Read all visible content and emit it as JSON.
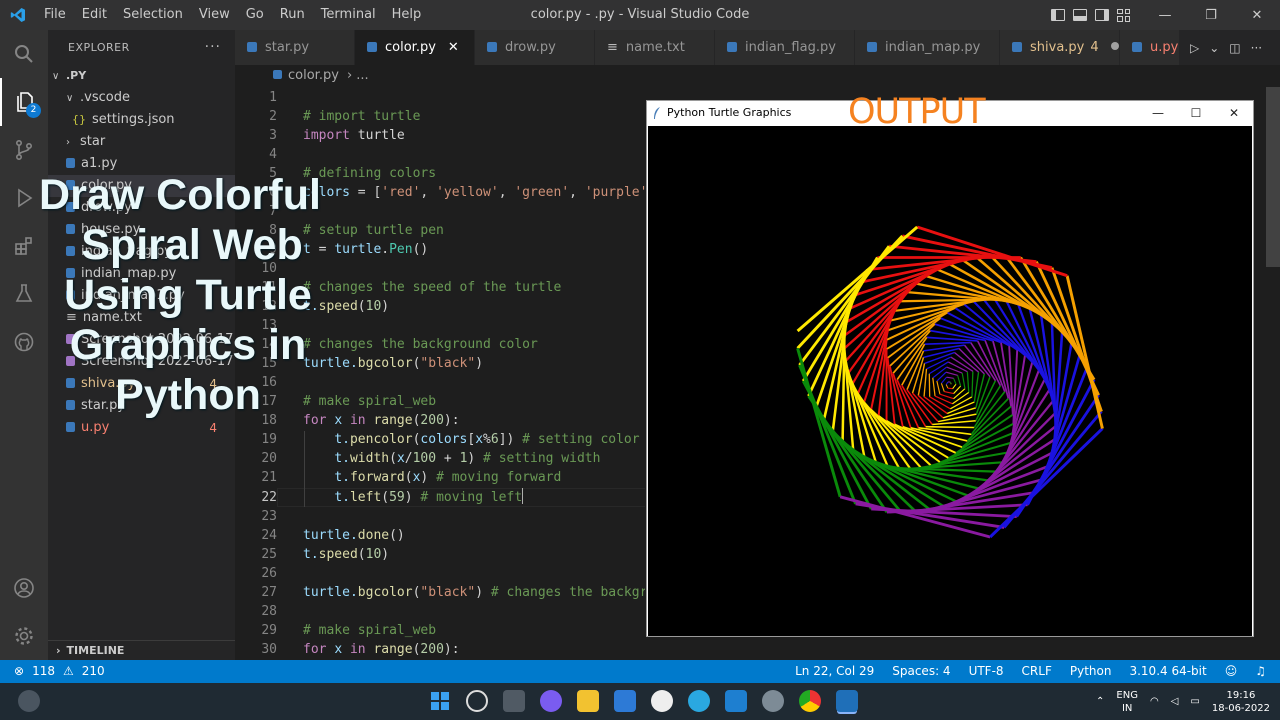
{
  "window": {
    "title": "color.py - .py - Visual Studio Code",
    "menu": [
      "File",
      "Edit",
      "Selection",
      "View",
      "Go",
      "Run",
      "Terminal",
      "Help"
    ]
  },
  "activity": {
    "explorer_badge": "2"
  },
  "sidebar": {
    "header": "EXPLORER",
    "root": ".PY",
    "items": [
      {
        "label": ".vscode",
        "kind": "folder-open"
      },
      {
        "label": "settings.json",
        "kind": "json"
      },
      {
        "label": "star",
        "kind": "folder"
      },
      {
        "label": "a1.py",
        "kind": "py"
      },
      {
        "label": "color.py",
        "kind": "py"
      },
      {
        "label": "drow.py",
        "kind": "py"
      },
      {
        "label": "house.py",
        "kind": "py"
      },
      {
        "label": "indian_flag.py",
        "kind": "py"
      },
      {
        "label": "indian_map.py",
        "kind": "py"
      },
      {
        "label": "indian_map1.py",
        "kind": "py"
      },
      {
        "label": "name.txt",
        "kind": "txt"
      },
      {
        "label": "Screenshot 2022-06-17 ...",
        "kind": "img"
      },
      {
        "label": "Screenshot 2022-06-17 ...",
        "kind": "img"
      },
      {
        "label": "shiva.py",
        "kind": "py",
        "badge": "4"
      },
      {
        "label": "star.py",
        "kind": "py"
      },
      {
        "label": "u.py",
        "kind": "py",
        "badge": "4"
      }
    ],
    "timeline": "TIMELINE"
  },
  "tabs": [
    {
      "label": "star.py"
    },
    {
      "label": "color.py"
    },
    {
      "label": "drow.py"
    },
    {
      "label": "name.txt"
    },
    {
      "label": "indian_flag.py"
    },
    {
      "label": "indian_map.py"
    },
    {
      "label": "shiva.py",
      "badge": "4"
    },
    {
      "label": "u.py"
    }
  ],
  "breadcrumb": {
    "folder": ".PY",
    "file": "color.py",
    "sep": "›",
    "more": "..."
  },
  "editor": {
    "lines": [
      {
        "n": "1"
      },
      {
        "n": "2"
      },
      {
        "n": "3"
      },
      {
        "n": "4"
      },
      {
        "n": "5"
      },
      {
        "n": "6"
      },
      {
        "n": "7"
      },
      {
        "n": "8"
      },
      {
        "n": "9"
      },
      {
        "n": "10"
      },
      {
        "n": "11"
      },
      {
        "n": "12"
      },
      {
        "n": "13"
      },
      {
        "n": "14"
      },
      {
        "n": "15"
      },
      {
        "n": "16"
      },
      {
        "n": "17"
      },
      {
        "n": "18"
      },
      {
        "n": "19"
      },
      {
        "n": "20"
      },
      {
        "n": "21"
      },
      {
        "n": "22"
      },
      {
        "n": "23"
      },
      {
        "n": "24"
      },
      {
        "n": "25"
      },
      {
        "n": "26"
      },
      {
        "n": "27"
      },
      {
        "n": "28"
      },
      {
        "n": "29"
      },
      {
        "n": "30"
      }
    ]
  },
  "turtle_window": {
    "title": "Python Turtle Graphics",
    "minimize": "—",
    "maximize": "☐",
    "close": "✕"
  },
  "output_label": "OUTPUT",
  "headline": [
    "Draw Colorful",
    "Spiral Web",
    "Using Turtle",
    "Graphics in",
    "Python"
  ],
  "status": {
    "errors": "118",
    "warnings": "210",
    "position": "Ln 22, Col 29",
    "spaces": "Spaces: 4",
    "encoding": "UTF-8",
    "eol": "CRLF",
    "language": "Python",
    "interpreter": "3.10.4 64-bit"
  },
  "taskbar": {
    "lang1": "ENG",
    "lang2": "IN",
    "time": "19:16",
    "date": "18-06-2022"
  },
  "colors": {
    "accent": "#007acc",
    "orange": "#f58220",
    "spiral": [
      "#e81010",
      "#ffe800",
      "#0a8a0a",
      "#8a1aa0",
      "#1a12e0",
      "#f5a000"
    ]
  }
}
